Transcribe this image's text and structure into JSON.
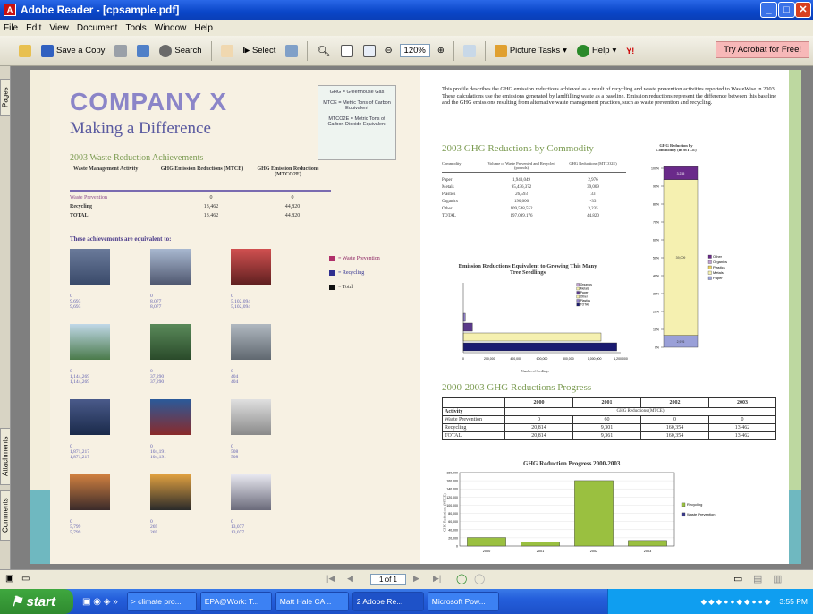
{
  "window": {
    "title": "Adobe Reader - [cpsample.pdf]"
  },
  "menu": [
    "File",
    "Edit",
    "View",
    "Document",
    "Tools",
    "Window",
    "Help"
  ],
  "toolbar": {
    "save_copy": "Save a Copy",
    "search": "Search",
    "select": "Select",
    "zoom": "120%",
    "picture_tasks": "Picture Tasks",
    "help": "Help",
    "try_acrobat": "Try Acrobat for Free!"
  },
  "side_tabs": {
    "pages": "Pages",
    "attachments": "Attachments",
    "comments": "Comments"
  },
  "doc": {
    "company": "COMPANY X",
    "subtitle": "Making a Difference",
    "definitions": [
      "GHG = Greenhouse Gas",
      "MTCE = Metric Tons of Carbon Equivalent",
      "MTCO2E = Metric Tons of Carbon Dioxide Equivalent"
    ],
    "intro": "This profile describes the GHG emission reductions achieved as a result of recycling and waste prevention activities reported to WasteWise in 2003. These calculations use the emissions generated by landfilling waste as a baseline. Emission reductions represent the difference between this baseline and the GHG emissions resulting from alternative waste management practices, such as waste prevention and recycling.",
    "achievements": {
      "heading": "2003 Waste Reduction Achievements",
      "cols": [
        "Waste Management Activity",
        "GHG Emission Reductions (MTCE)",
        "GHG Emission Reductions (MTCO2E)"
      ],
      "rows": [
        [
          "Waste Prevention",
          "0",
          "0"
        ],
        [
          "Recycling",
          "13,462",
          "44,820"
        ],
        [
          "TOTAL",
          "13,462",
          "44,820"
        ]
      ]
    },
    "equivalent_heading": "These achievements are equivalent to:",
    "legend": [
      "= Waste Prevention",
      "= Recycling",
      "= Total"
    ],
    "equivalents": [
      {
        "v": "0",
        "a": "9,693",
        "b": "9,693"
      },
      {
        "v": "0",
        "a": "8,077",
        "b": "8,077"
      },
      {
        "v": "0",
        "a": "5,102,094",
        "b": "5,102,094"
      },
      {
        "v": "0",
        "a": "1,144,269",
        "b": "1,144,269"
      },
      {
        "v": "0",
        "a": "37,290",
        "b": "37,290"
      },
      {
        "v": "0",
        "a": "404",
        "b": "404"
      },
      {
        "v": "0",
        "a": "1,871,217",
        "b": "1,871,217"
      },
      {
        "v": "0",
        "a": "104,191",
        "b": "104,191"
      },
      {
        "v": "0",
        "a": "508",
        "b": "508"
      },
      {
        "v": "0",
        "a": "5,799",
        "b": "5,799"
      },
      {
        "v": "0",
        "a": "269",
        "b": "269"
      },
      {
        "v": "0",
        "a": "13,077",
        "b": "13,077"
      }
    ],
    "commodity": {
      "heading": "2003 GHG Reductions by Commodity",
      "cols": [
        "Commodity",
        "Volume of Waste Prevented and Recycled (pounds)",
        "GHG Reductions (MTCO2E)"
      ],
      "rows": [
        [
          "Paper",
          "1,940,049",
          "2,976"
        ],
        [
          "Metals",
          "95,436,372",
          "39,009"
        ],
        [
          "Plastics",
          "26,593",
          "33"
        ],
        [
          "Organics",
          "190,000",
          "-33"
        ],
        [
          "Other",
          "109,548,552",
          "3,235"
        ],
        [
          "TOTAL",
          "197,099,176",
          "44,820"
        ]
      ]
    },
    "stack_title": "GHG Reduction by Commodity (in MTCE)",
    "stack_legend": [
      "Other",
      "Organics",
      "Plastics",
      "Metals",
      "Paper"
    ],
    "seedling_title": "Emission Reductions Equivalent to Growing This Many Tree Seedlings",
    "seedling_legend": [
      "Organics",
      "Metals",
      "Paper",
      "Other",
      "Plastics",
      "TOTAL"
    ],
    "seedling_axis": [
      "0",
      "200,000",
      "400,000",
      "600,000",
      "800,000",
      "1,000,000",
      "1,200,000"
    ],
    "seedling_xlabel": "Number of Seedlings",
    "progress": {
      "heading": "2000-2003 GHG Reductions Progress",
      "years": [
        "2000",
        "2001",
        "2002",
        "2003"
      ],
      "activity": "Activity",
      "subhead": "GHG Reductions (MTCE)",
      "rows": [
        [
          "Waste Prevention",
          "0",
          "60",
          "0",
          "0"
        ],
        [
          "Recycling",
          "20,814",
          "9,301",
          "160,354",
          "13,462"
        ],
        [
          "TOTAL",
          "20,814",
          "9,361",
          "160,354",
          "13,462"
        ]
      ]
    },
    "bar_title": "GHG Reduction Progress 2000-2003",
    "bar_ylabel": "GHG Reductions (MTCE)",
    "bar_legend": [
      "Recycling",
      "Waste Prevention"
    ],
    "bar_yticks": [
      "180,000",
      "160,000",
      "140,000",
      "120,000",
      "100,000",
      "80,000",
      "60,000",
      "40,000",
      "20,000",
      "0"
    ]
  },
  "chart_data": [
    {
      "type": "bar",
      "title": "Emission Reductions Equivalent to Growing This Many Tree Seedlings",
      "xlabel": "Number of Seedlings",
      "categories": [
        "Plastics",
        "Paper",
        "Other",
        "TOTAL"
      ],
      "values": [
        15000,
        70000,
        1050000,
        1170000
      ],
      "xlim": [
        0,
        1200000
      ]
    },
    {
      "type": "bar",
      "title": "GHG Reduction Progress 2000-2003",
      "ylabel": "GHG Reductions (MTCE)",
      "categories": [
        "2000",
        "2001",
        "2002",
        "2003"
      ],
      "series": [
        {
          "name": "Recycling",
          "values": [
            20814,
            9301,
            160354,
            13462
          ]
        },
        {
          "name": "Waste Prevention",
          "values": [
            0,
            60,
            0,
            0
          ]
        }
      ],
      "ylim": [
        0,
        180000
      ]
    }
  ],
  "statusbar": {
    "page": "1 of 1"
  },
  "taskbar": {
    "start": "start",
    "tasks": [
      "> climate pro...",
      "EPA@Work: T...",
      "Matt Hale CA...",
      "2 Adobe Re...",
      "Microsoft Pow..."
    ],
    "clock": "3:55 PM"
  }
}
